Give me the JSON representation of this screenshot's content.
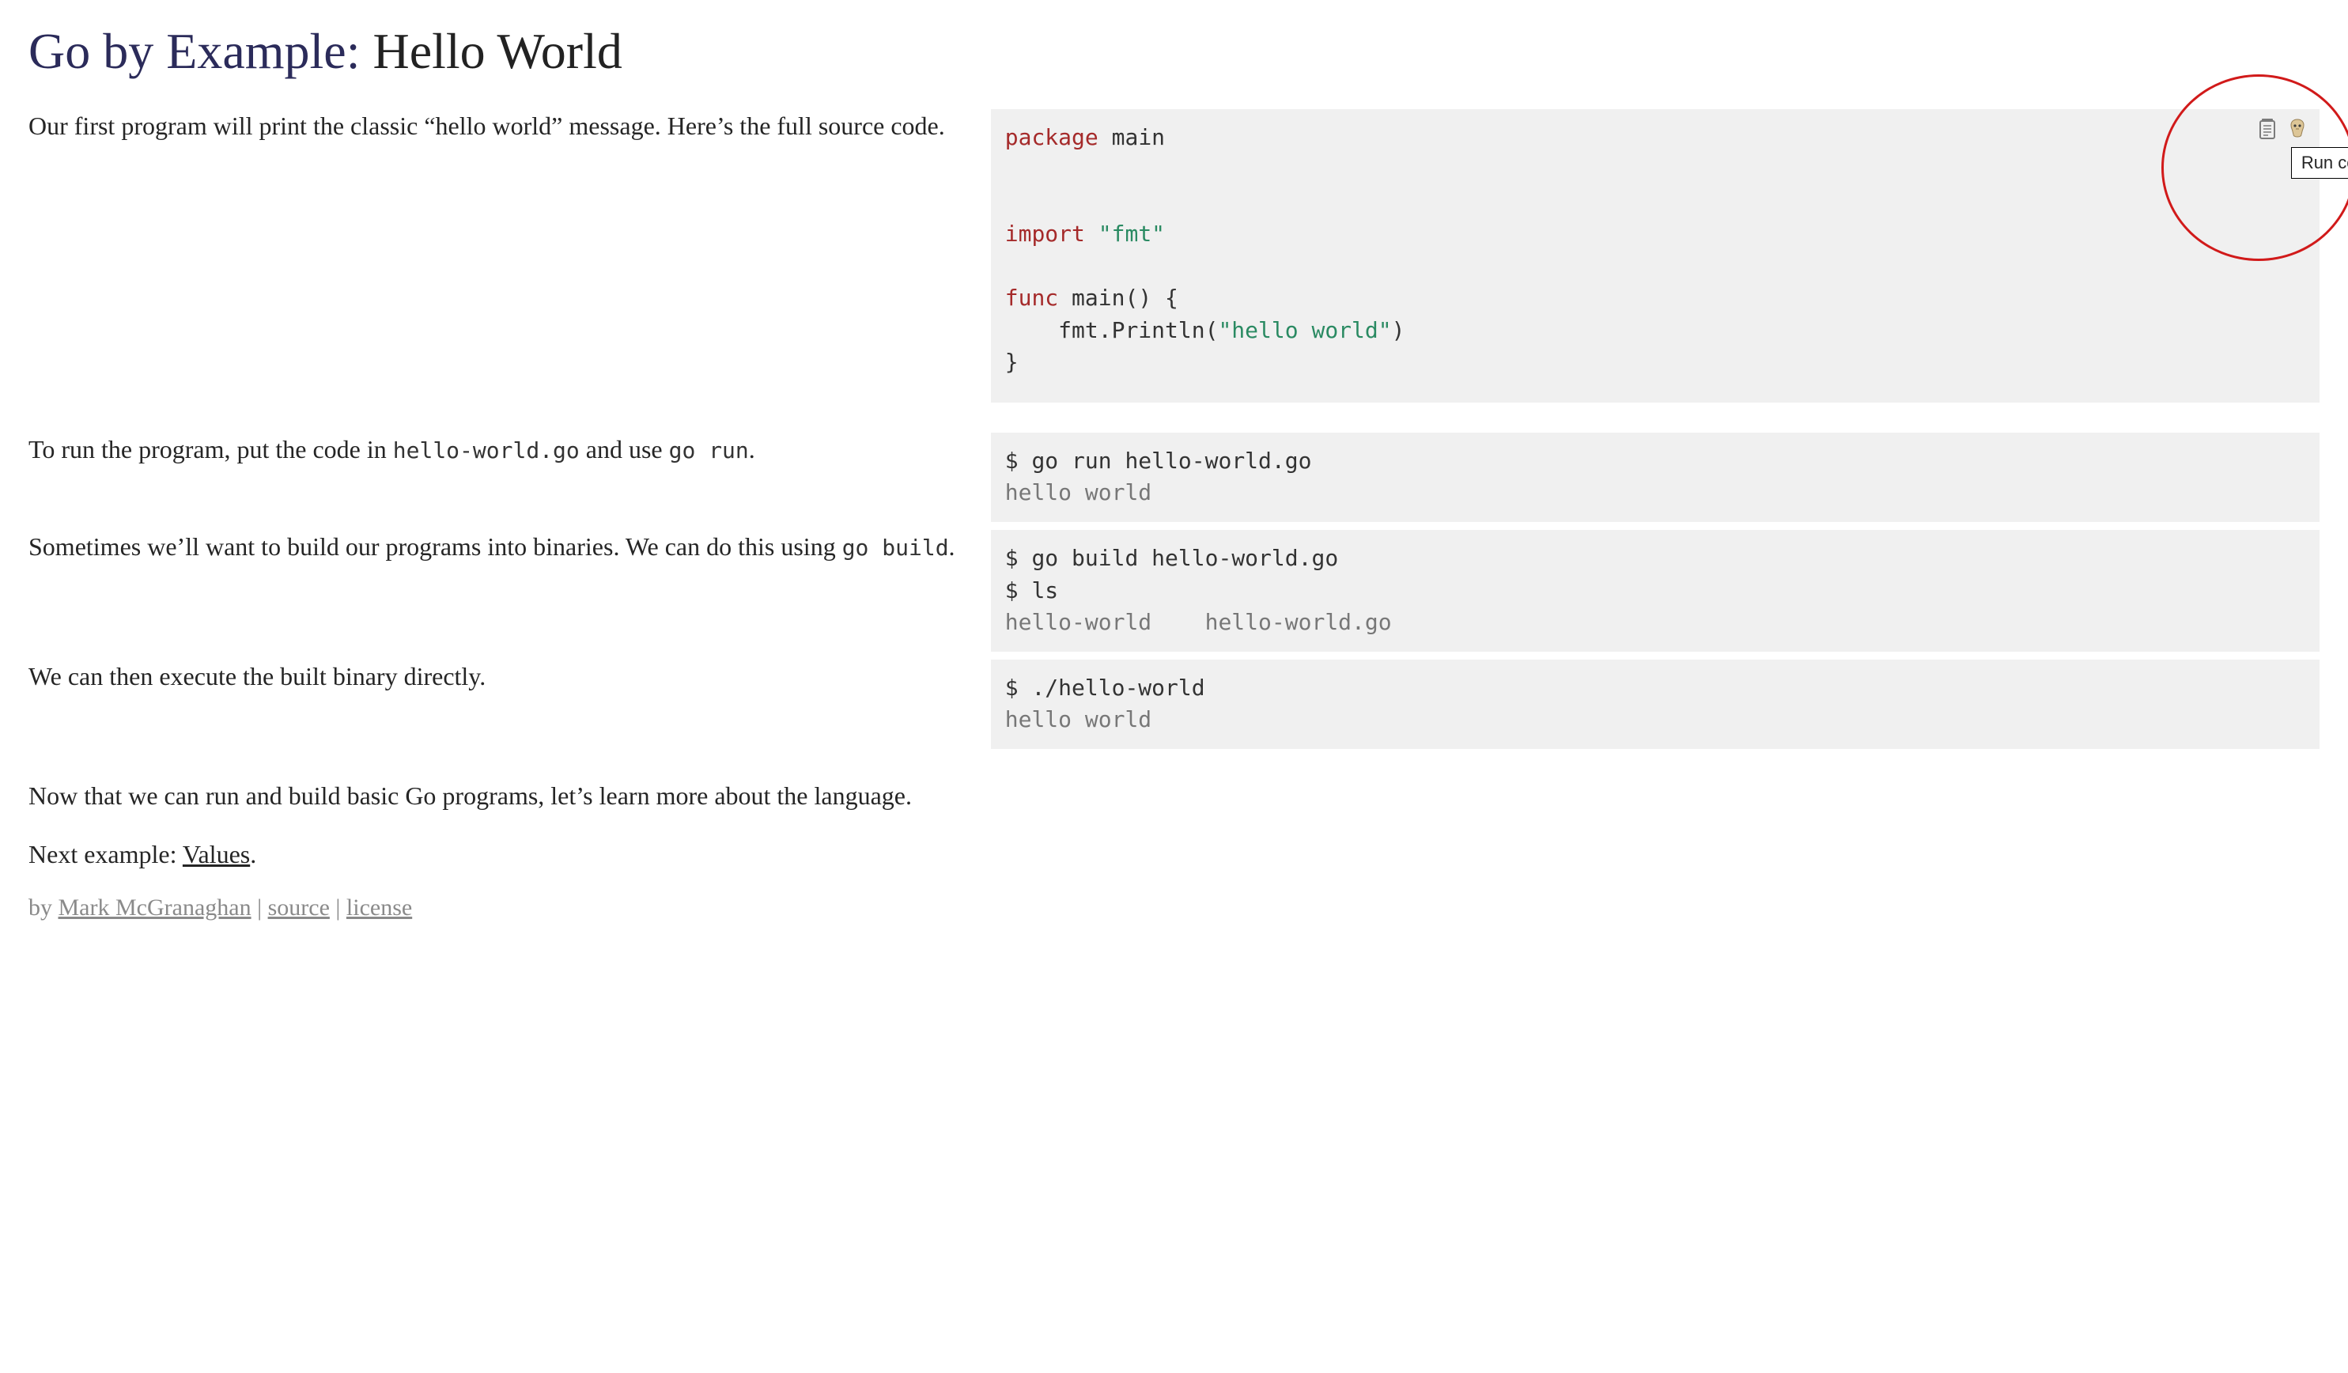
{
  "header": {
    "brand": "Go by Example",
    "separator": ": ",
    "topic": "Hello World"
  },
  "tooltip": "Run code",
  "rows": {
    "r1": {
      "doc": "Our first program will print the classic “hello world” message. Here’s the full source code.",
      "code_tokens": {
        "t1": "package",
        "t2": " main",
        "t3": "import",
        "t4": " ",
        "t5": "\"fmt\"",
        "t6": "func",
        "t7": " main() {",
        "t8": "    fmt.Println(",
        "t9": "\"hello world\"",
        "t10": ")",
        "t11": "}"
      }
    },
    "r2": {
      "doc_pre": "To run the program, put the code in ",
      "doc_code1": "hello-world.go",
      "doc_mid": " and use ",
      "doc_code2": "go run",
      "doc_post": ".",
      "shell": {
        "l1p": "$",
        "l1c": " go run hello-world.go",
        "l2": "hello world"
      }
    },
    "r3": {
      "doc_pre": "Sometimes we’ll want to build our programs into binaries. We can do this using ",
      "doc_code1": "go build",
      "doc_post": ".",
      "shell": {
        "l1p": "$",
        "l1c": " go build hello-world.go",
        "l2p": "$",
        "l2c": " ls",
        "l3": "hello-world    hello-world.go"
      }
    },
    "r4": {
      "doc": "We can then execute the built binary directly.",
      "shell": {
        "l1p": "$",
        "l1c": " ./hello-world",
        "l2": "hello world"
      }
    },
    "r5": {
      "doc": "Now that we can run and build basic Go programs, let’s learn more about the language."
    }
  },
  "next": {
    "prefix": "Next example: ",
    "link": "Values",
    "suffix": "."
  },
  "footer": {
    "by": "by ",
    "author": "Mark McGranaghan",
    "sep": " | ",
    "source": "source",
    "license": "license"
  }
}
